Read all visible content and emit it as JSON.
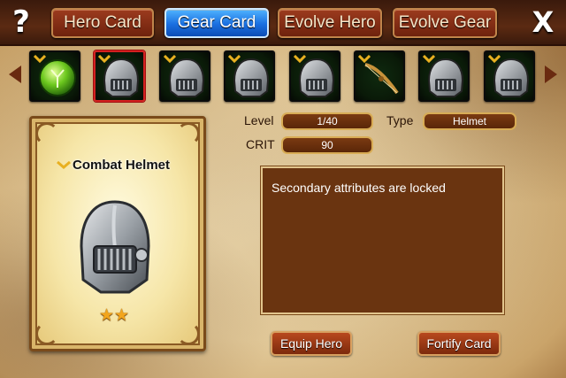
{
  "top_bar": {
    "help_glyph": "?",
    "close_glyph": "X",
    "tabs": [
      {
        "label": "Hero Card",
        "active": false
      },
      {
        "label": "Gear Card",
        "active": true
      },
      {
        "label": "Evolve Hero",
        "active": false
      },
      {
        "label": "Evolve Gear",
        "active": false
      }
    ]
  },
  "gear_strip": {
    "items": [
      {
        "icon": "green-orb-icon",
        "selected": false,
        "has_chevron": true
      },
      {
        "icon": "helmet-icon",
        "selected": true,
        "has_chevron": true
      },
      {
        "icon": "helmet-icon",
        "selected": false,
        "has_chevron": true
      },
      {
        "icon": "helmet-icon",
        "selected": false,
        "has_chevron": true
      },
      {
        "icon": "helmet-icon",
        "selected": false,
        "has_chevron": true
      },
      {
        "icon": "bow-icon",
        "selected": false,
        "has_chevron": true
      },
      {
        "icon": "helmet-icon",
        "selected": false,
        "has_chevron": true
      },
      {
        "icon": "helmet-icon",
        "selected": false,
        "has_chevron": true
      }
    ]
  },
  "card": {
    "name": "Combat Helmet",
    "stars": 2,
    "star_glyph": "★"
  },
  "stats": {
    "level_label": "Level",
    "level_value": "1/40",
    "type_label": "Type",
    "type_value": "Helmet",
    "crit_label": "CRIT",
    "crit_value": "90"
  },
  "attributes": {
    "text": "Secondary attributes are locked"
  },
  "actions": {
    "equip_label": "Equip Hero",
    "fortify_label": "Fortify Card"
  },
  "colors": {
    "active_tab": "#1a6fe0",
    "selected_border": "#d42020",
    "star": "#f2a51c"
  }
}
